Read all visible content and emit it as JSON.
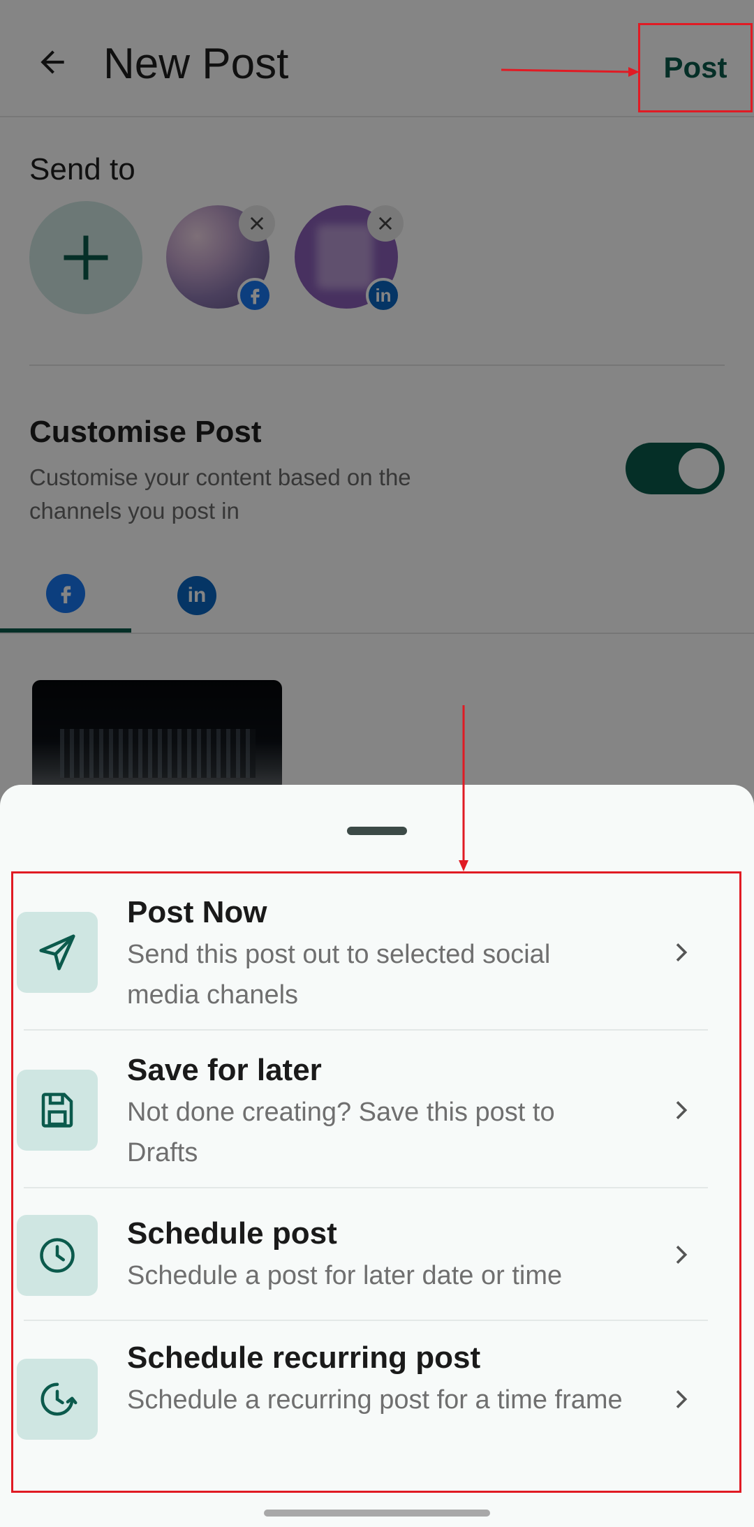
{
  "app_bar": {
    "title": "New Post",
    "back_icon": "arrow-left-icon",
    "post_label": "Post"
  },
  "send_to": {
    "label": "Send to",
    "channels": [
      {
        "network": "facebook",
        "badge_icon": "facebook-icon"
      },
      {
        "network": "linkedin",
        "badge_icon": "linkedin-icon",
        "badge_text": "in"
      }
    ]
  },
  "customise": {
    "title": "Customise Post",
    "subtitle": "Customise your content based on the channels you post in",
    "toggle_on": true
  },
  "tabs": [
    {
      "network": "facebook",
      "icon": "facebook-icon",
      "selected": true
    },
    {
      "network": "linkedin",
      "icon": "linkedin-icon",
      "text": "in",
      "selected": false
    }
  ],
  "sheet": {
    "options": [
      {
        "title": "Post Now",
        "description": "Send this post out to selected social media chanels",
        "icon": "send-icon"
      },
      {
        "title": "Save for later",
        "description": "Not done creating? Save this post to Drafts",
        "icon": "save-icon"
      },
      {
        "title": "Schedule post",
        "description": "Schedule a post for later date or time",
        "icon": "clock-icon"
      },
      {
        "title": "Schedule recurring post",
        "description": "Schedule a recurring post for a time frame",
        "icon": "recurring-clock-icon"
      }
    ]
  },
  "colors": {
    "accent": "#0b5a4c",
    "tile": "#cfe6e2",
    "annotation": "#e01b24",
    "facebook": "#1877f2",
    "linkedin": "#0a66c2"
  }
}
